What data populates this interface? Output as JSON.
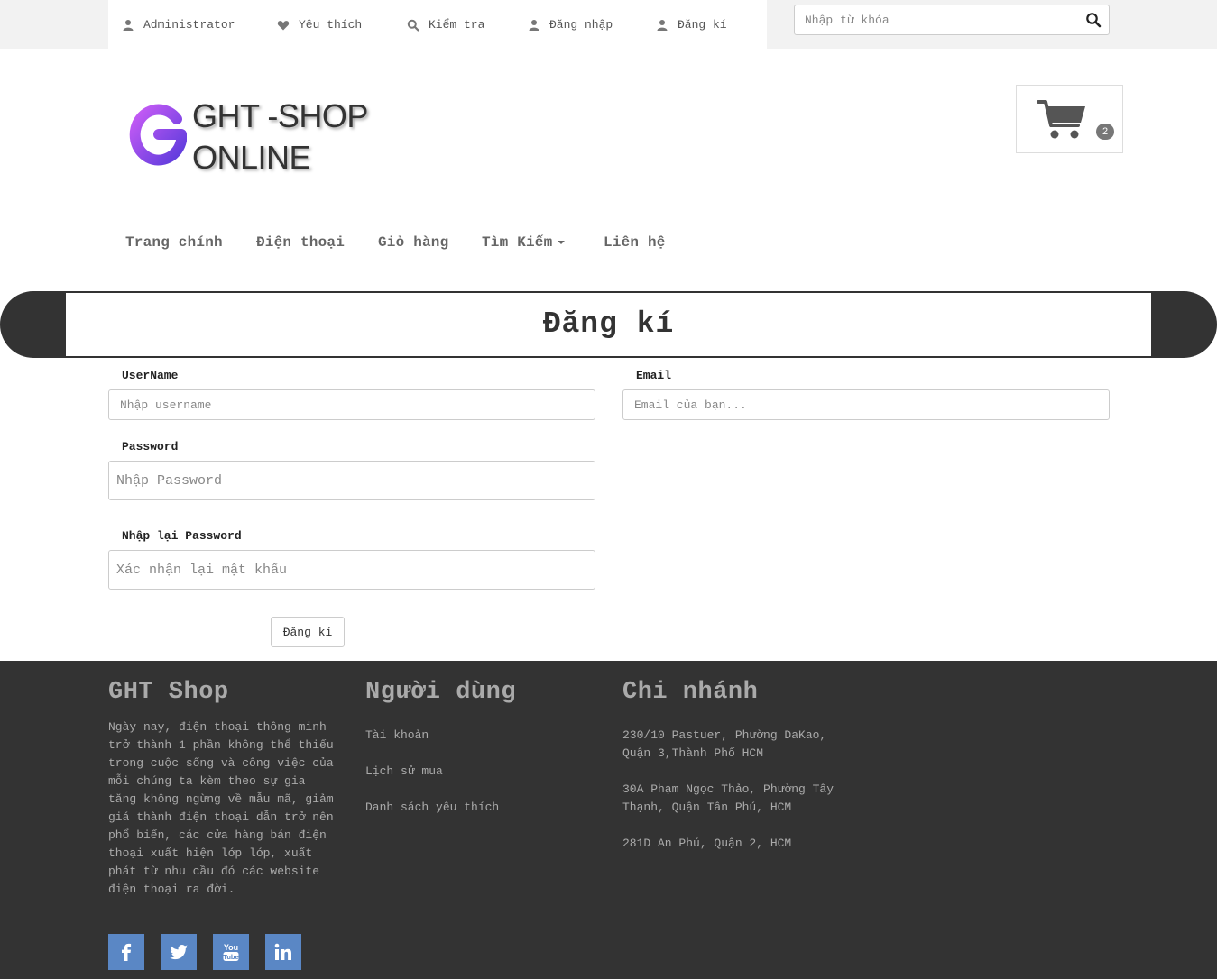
{
  "topbar": {
    "links": [
      {
        "label": "Administrator",
        "icon": "user-icon"
      },
      {
        "label": "Yêu thích",
        "icon": "heart-icon"
      },
      {
        "label": "Kiểm tra",
        "icon": "search-icon"
      },
      {
        "label": "Đăng nhập",
        "icon": "user-icon"
      },
      {
        "label": "Đăng kí",
        "icon": "user-icon"
      }
    ],
    "search_placeholder": "Nhập từ khóa"
  },
  "header": {
    "logo_line1": "GHT -SHOP",
    "logo_line2": "ONLINE",
    "cart_count": "2"
  },
  "nav": {
    "items": [
      "Trang chính",
      "Điện thoại",
      "Giỏ hàng",
      "Tìm Kiếm",
      "Liên hệ"
    ]
  },
  "page": {
    "title": "Đăng kí"
  },
  "form": {
    "username_label": "UserName",
    "username_placeholder": "Nhập username",
    "email_label": "Email",
    "email_placeholder": "Email của bạn...",
    "password_label": "Password",
    "password_placeholder": "Nhập Password",
    "confirm_label": "Nhập lại Password",
    "confirm_placeholder": "Xác nhận lại mật khẩu",
    "submit_label": "Đăng kí"
  },
  "footer": {
    "about_title": "GHT Shop",
    "about_text": "Ngày nay, điện thoại thông minh trở thành 1 phần không thể thiếu trong cuộc sống và công việc của mỗi chúng ta kèm theo sự gia tăng không ngừng về mẫu mã, giảm giá thành điện thoại dẫn trở nên phổ biến, các cửa hàng bán điện thoại xuất hiện lớp lớp, xuất phát từ nhu cầu đó các website điện thoại ra đời.",
    "user_title": "Người dùng",
    "user_links": [
      "Tài khoản",
      "Lịch sử mua",
      "Danh sách yêu thích"
    ],
    "branch_title": "Chi nhánh",
    "branches": [
      "230/10 Pastuer, Phường DaKao, Quận 3,Thành Phố HCM",
      "30A Phạm Ngọc Thảo, Phường Tây Thạnh, Quận Tân Phú, HCM",
      "281D An Phú, Quận 2, HCM"
    ],
    "social": [
      "facebook-icon",
      "twitter-icon",
      "youtube-icon",
      "linkedin-icon"
    ]
  },
  "colors": {
    "dark": "#333333",
    "social_blue": "#5a87c5",
    "logo_gradient_start": "#b455f5",
    "logo_gradient_end": "#6a3ee0"
  }
}
